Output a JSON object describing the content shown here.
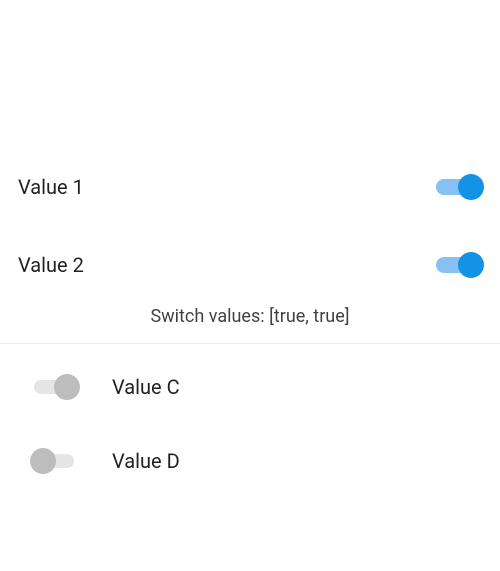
{
  "top_switches": [
    {
      "label": "Value 1",
      "on": true
    },
    {
      "label": "Value 2",
      "on": true
    }
  ],
  "status_text": "Switch values: [true, true]",
  "bottom_switches": [
    {
      "label": "Value C",
      "knob_side": "right"
    },
    {
      "label": "Value D",
      "knob_side": "left"
    }
  ]
}
